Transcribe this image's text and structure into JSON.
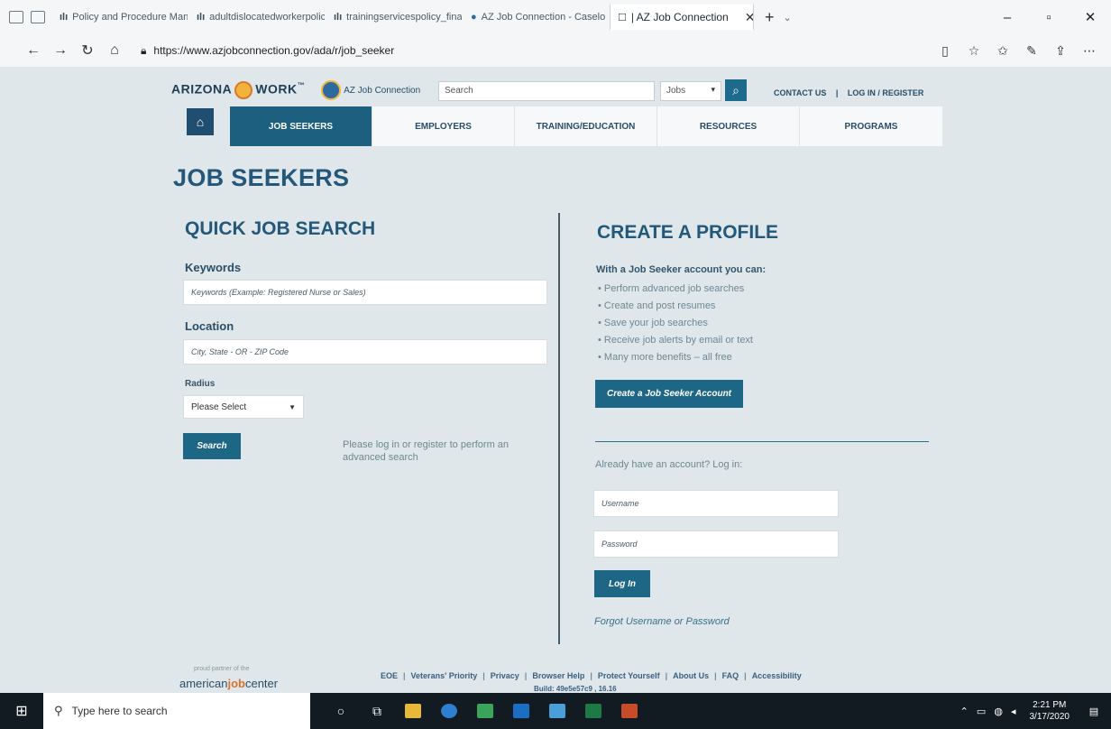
{
  "browser": {
    "tabs": [
      {
        "label": "Policy and Procedure Manu",
        "active": false
      },
      {
        "label": "adultdislocatedworkerpolic",
        "active": false
      },
      {
        "label": "trainingservicespolicy_final",
        "active": false
      },
      {
        "label": "AZ Job Connection - Caselo",
        "active": false
      },
      {
        "label": "| AZ Job Connection",
        "active": true
      }
    ],
    "url": "https://www.azjobconnection.gov/ada/r/job_seeker"
  },
  "header": {
    "logo_left": "ARIZONA",
    "logo_right": "WORK",
    "logo_tm": "™",
    "logo_ajc": "AZ Job Connection",
    "search_placeholder": "Search",
    "search_scope": "Jobs",
    "contact_us": "CONTACT US",
    "separator": "|",
    "login_register": "LOG IN / REGISTER"
  },
  "nav": {
    "items": [
      "JOB SEEKERS",
      "EMPLOYERS",
      "TRAINING/EDUCATION",
      "RESOURCES",
      "PROGRAMS"
    ]
  },
  "page": {
    "title": "JOB SEEKERS"
  },
  "quick_search": {
    "title": "QUICK JOB SEARCH",
    "keywords_label": "Keywords",
    "keywords_placeholder": "Keywords (Example: Registered Nurse or Sales)",
    "location_label": "Location",
    "location_placeholder": "City, State - OR - ZIP Code",
    "radius_label": "Radius",
    "radius_value": "Please Select",
    "search_button": "Search",
    "advanced_hint": "Please log in or register to perform an advanced search"
  },
  "profile": {
    "title": "CREATE A PROFILE",
    "intro": "With a Job Seeker account you can:",
    "benefits": [
      "Perform advanced job searches",
      "Create and post resumes",
      "Save your job searches",
      "Receive job alerts by email or text",
      "Many more benefits – all free"
    ],
    "create_button": "Create a Job Seeker Account",
    "login_prompt": "Already have an account? Log in:",
    "username_placeholder": "Username",
    "password_placeholder": "Password",
    "login_button": "Log In",
    "forgot_link": "Forgot Username or Password"
  },
  "footer": {
    "partner_text": "proud partner of the",
    "ajc_prefix": "american",
    "ajc_mid": "job",
    "ajc_suffix": "center",
    "links": [
      "EOE",
      "Veterans' Priority",
      "Privacy",
      "Browser Help",
      "Protect Yourself",
      "About Us",
      "FAQ",
      "Accessibility"
    ],
    "build": "Build: 49e5e57c9 , 16.16"
  },
  "taskbar": {
    "search_placeholder": "Type here to search",
    "time": "2:21 PM",
    "date": "3/17/2020"
  },
  "colors": {
    "accent": "#1d5f7e",
    "heading": "#24587a",
    "background": "#dfe7ea"
  }
}
